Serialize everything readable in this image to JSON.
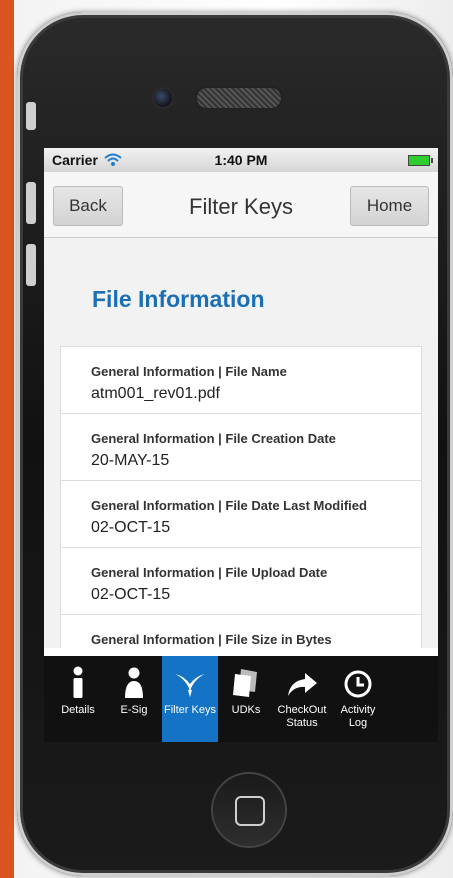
{
  "status": {
    "carrier": "Carrier",
    "time": "1:40 PM"
  },
  "nav": {
    "back": "Back",
    "title": "Filter Keys",
    "home": "Home"
  },
  "page": {
    "title": "File Information"
  },
  "rows": [
    {
      "label": "General Information | File Name",
      "value": "atm001_rev01.pdf"
    },
    {
      "label": "General Information | File Creation Date",
      "value": "20-MAY-15"
    },
    {
      "label": "General Information | File Date Last Modified",
      "value": "02-OCT-15"
    },
    {
      "label": "General Information | File Upload Date",
      "value": "02-OCT-15"
    },
    {
      "label": "General Information | File Size in Bytes",
      "value": ""
    }
  ],
  "tabs": [
    {
      "label": "Details",
      "icon": "info-icon"
    },
    {
      "label": "E-Sig",
      "icon": "person-icon"
    },
    {
      "label": "Filter Keys",
      "icon": "filter-keys-icon"
    },
    {
      "label": "UDKs",
      "icon": "documents-icon"
    },
    {
      "label": "CheckOut Status",
      "icon": "share-arrow-icon"
    },
    {
      "label": "Activity Log",
      "icon": "clock-icon"
    }
  ],
  "colors": {
    "accent": "#1a6fb5",
    "active_tab": "#1473c5",
    "background": "#d9541e"
  }
}
